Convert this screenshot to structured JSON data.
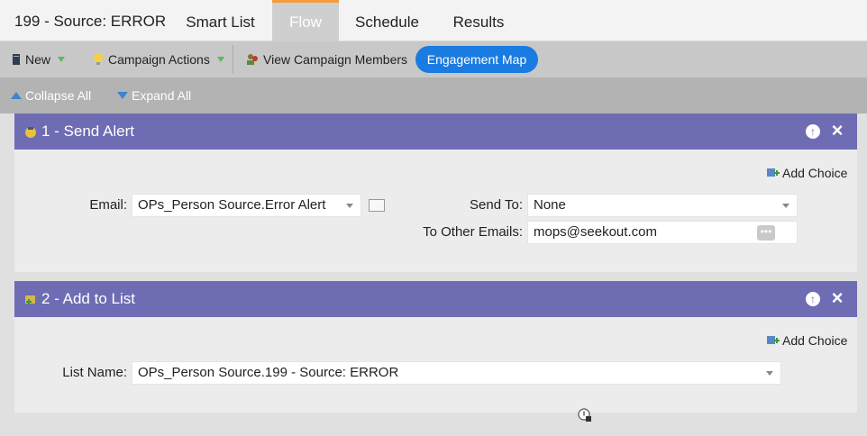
{
  "header": {
    "title": "199 - Source: ERROR",
    "tabs": [
      {
        "label": "Smart List"
      },
      {
        "label": "Flow",
        "active": true
      },
      {
        "label": "Schedule"
      },
      {
        "label": "Results"
      }
    ]
  },
  "toolbar": {
    "new_label": "New",
    "campaign_actions_label": "Campaign Actions",
    "view_members_label": "View Campaign Members",
    "engagement_map_label": "Engagement Map"
  },
  "subbar": {
    "collapse_label": "Collapse All",
    "expand_label": "Expand All"
  },
  "steps": [
    {
      "title": "1 - Send Alert",
      "add_choice": "Add Choice",
      "email_label": "Email:",
      "email_value": "OPs_Person Source.Error Alert",
      "send_to_label": "Send To:",
      "send_to_value": "None",
      "other_emails_label": "To Other Emails:",
      "other_emails_value": "mops@seekout.com"
    },
    {
      "title": "2 - Add to List",
      "add_choice": "Add Choice",
      "list_name_label": "List Name:",
      "list_name_value": "OPs_Person Source.199 - Source: ERROR"
    }
  ],
  "colors": {
    "step_header": "#6e6cb3",
    "engagement_button": "#1a7be0",
    "active_tab_accent": "#f39c3a"
  }
}
